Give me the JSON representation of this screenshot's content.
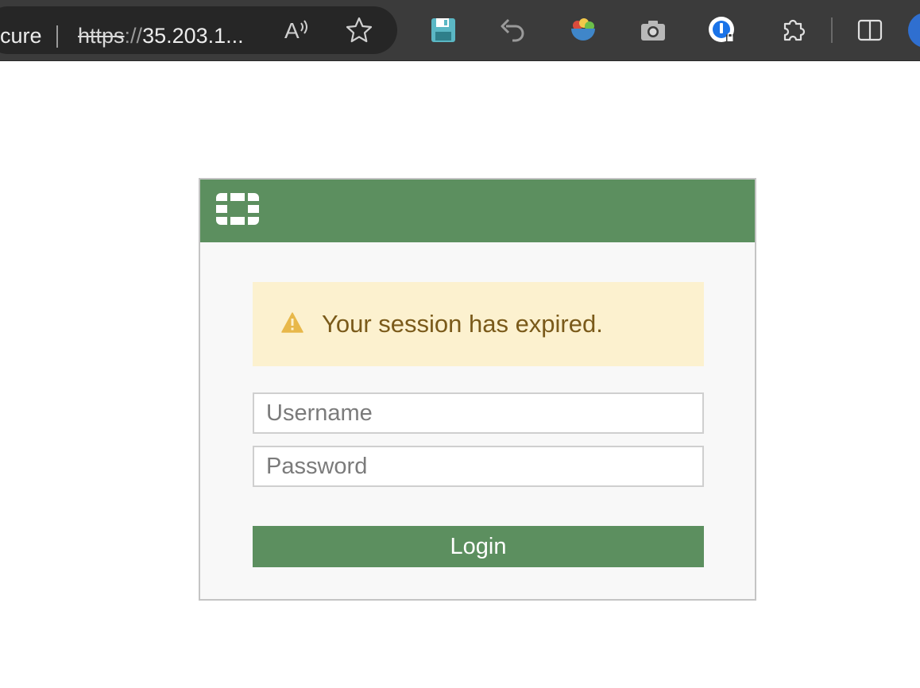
{
  "browser": {
    "security_label": "cure",
    "url_scheme": "https",
    "url_slashes": "://",
    "url_rest": "35.203.1...",
    "read_aloud_glyph": "Aʾ",
    "icons": [
      "read-aloud-icon",
      "favorite-star-icon",
      "save-icon",
      "undo-icon",
      "extension-salad-icon",
      "camera-icon",
      "password-manager-icon",
      "extensions-puzzle-icon",
      "split-screen-icon",
      "profile-avatar"
    ]
  },
  "login": {
    "alert_message": "Your session has expired.",
    "username_placeholder": "Username",
    "password_placeholder": "Password",
    "login_label": "Login"
  },
  "colors": {
    "header_green": "#5c8f5f",
    "alert_background": "#fcf1cf",
    "alert_text": "#7a5a1a",
    "warning_icon": "#e8b84a",
    "toolbar_background": "#3b3b3b"
  }
}
